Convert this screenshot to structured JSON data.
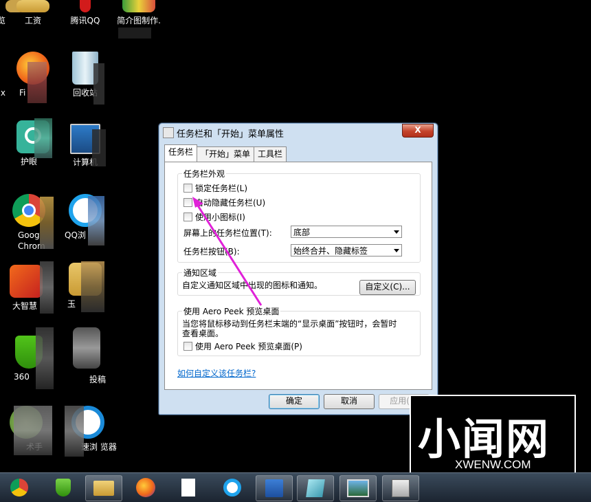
{
  "desktop": {
    "icons": [
      {
        "label": "览",
        "col": 0
      },
      {
        "label": "工资"
      },
      {
        "label": "腾讯QQ"
      },
      {
        "label": "简介图制作."
      },
      {
        "label": "Fi"
      },
      {
        "label": "x"
      },
      {
        "label": "回收站"
      },
      {
        "label": "护眼"
      },
      {
        "label": "计算机"
      },
      {
        "label": "Goog Chrom"
      },
      {
        "label": "QQ浏"
      },
      {
        "label": "大智慧"
      },
      {
        "label": "玉"
      },
      {
        "label": "360"
      },
      {
        "label": "投稿"
      },
      {
        "label": "术手"
      },
      {
        "label": "速浏 览器"
      }
    ]
  },
  "dialog": {
    "title": "任务栏和「开始」菜单属性",
    "close_label": "X",
    "tabs": [
      "任务栏",
      "「开始」菜单",
      "工具栏"
    ],
    "appearance": {
      "legend": "任务栏外观",
      "lock": "锁定任务栏(L)",
      "autohide": "自动隐藏任务栏(U)",
      "small_icons": "使用小图标(I)",
      "location_label": "屏幕上的任务栏位置(T):",
      "location_value": "底部",
      "buttons_label": "任务栏按钮(B):",
      "buttons_value": "始终合并、隐藏标签"
    },
    "notify": {
      "legend": "通知区域",
      "text": "自定义通知区域中出现的图标和通知。",
      "customize": "自定义(C)..."
    },
    "aero": {
      "legend": "使用 Aero Peek 预览桌面",
      "desc_line1": "当您将鼠标移动到任务栏末端的“显示桌面”按钮时，会暂时",
      "desc_line2": "查看桌面。",
      "checkbox": "使用 Aero Peek 预览桌面(P)"
    },
    "link": "如何自定义该任务栏?",
    "ok": "确定",
    "cancel": "取消",
    "apply": "应用(A)"
  },
  "watermark": {
    "big": "小闻网",
    "small": "XWENW.COM"
  },
  "taskbar": {
    "items": [
      "chrome-icon",
      "shield-icon",
      "explorer-icon",
      "firefox-icon",
      "document-icon",
      "qq-browser-icon",
      "word-icon",
      "notepad-icon",
      "picture-icon",
      "control-panel-icon"
    ]
  }
}
